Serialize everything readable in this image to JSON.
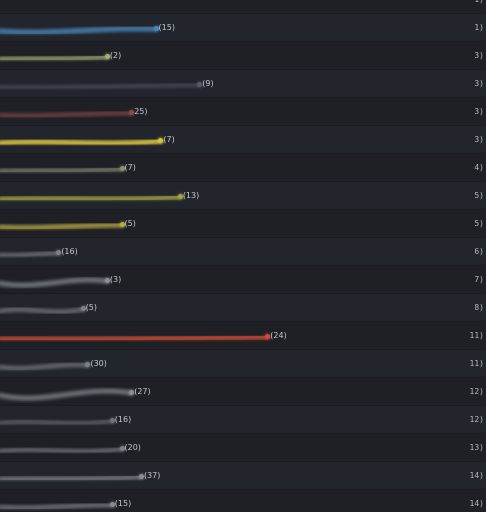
{
  "rows": [
    {
      "rank": "1)",
      "count": "",
      "color": "#3a4a5c",
      "len": 0,
      "lvl": 0,
      "curve": 0
    },
    {
      "rank": "1)",
      "count": "(15)",
      "color": "#4a86b8",
      "len": 0.32,
      "lvl": 0.8,
      "curve": -2
    },
    {
      "rank": "3)",
      "count": "(2)",
      "color": "#a4ae74",
      "len": 0.22,
      "lvl": 0.7,
      "curve": 3
    },
    {
      "rank": "3)",
      "count": "(9)",
      "color": "#555a63",
      "len": 0.41,
      "lvl": 0.35,
      "curve": 1
    },
    {
      "rank": "3)",
      "count": "25)",
      "color": "#8a4a48",
      "len": 0.27,
      "lvl": 0.5,
      "curve": 0
    },
    {
      "rank": "3)",
      "count": "(7)",
      "color": "#d6c340",
      "len": 0.33,
      "lvl": 1.0,
      "curve": 6
    },
    {
      "rank": "4)",
      "count": "(7)",
      "color": "#8d8f74",
      "len": 0.25,
      "lvl": 0.6,
      "curve": 3
    },
    {
      "rank": "5)",
      "count": "(13)",
      "color": "#a3a440",
      "len": 0.37,
      "lvl": 0.85,
      "curve": 4
    },
    {
      "rank": "5)",
      "count": "(5)",
      "color": "#b9aa44",
      "len": 0.25,
      "lvl": 0.75,
      "curve": 0
    },
    {
      "rank": "6)",
      "count": "(16)",
      "color": "#7c8088",
      "len": 0.12,
      "lvl": 0.55,
      "curve": 1
    },
    {
      "rank": "7)",
      "count": "(3)",
      "color": "#8c9096",
      "len": 0.22,
      "lvl": 0.6,
      "curve": -5
    },
    {
      "rank": "8)",
      "count": "(5)",
      "color": "#7d8187",
      "len": 0.17,
      "lvl": 0.55,
      "curve": 8
    },
    {
      "rank": "11)",
      "count": "(24)",
      "color": "#cc4a34",
      "len": 0.55,
      "lvl": 0.9,
      "curve": 2
    },
    {
      "rank": "11)",
      "count": "(30)",
      "color": "#7c8086",
      "len": 0.18,
      "lvl": 0.55,
      "curve": -2
    },
    {
      "rank": "12)",
      "count": "(27)",
      "color": "#8b8f95",
      "len": 0.27,
      "lvl": 0.6,
      "curve": -8
    },
    {
      "rank": "12)",
      "count": "(16)",
      "color": "#6f737a",
      "len": 0.23,
      "lvl": 0.45,
      "curve": 6
    },
    {
      "rank": "13)",
      "count": "(20)",
      "color": "#7d8187",
      "len": 0.25,
      "lvl": 0.55,
      "curve": 6
    },
    {
      "rank": "14)",
      "count": "(37)",
      "color": "#8a8e94",
      "len": 0.29,
      "lvl": 0.6,
      "curve": 3
    },
    {
      "rank": "14)",
      "count": "(15)",
      "color": "#858990",
      "len": 0.23,
      "lvl": 0.55,
      "curve": 0
    }
  ]
}
